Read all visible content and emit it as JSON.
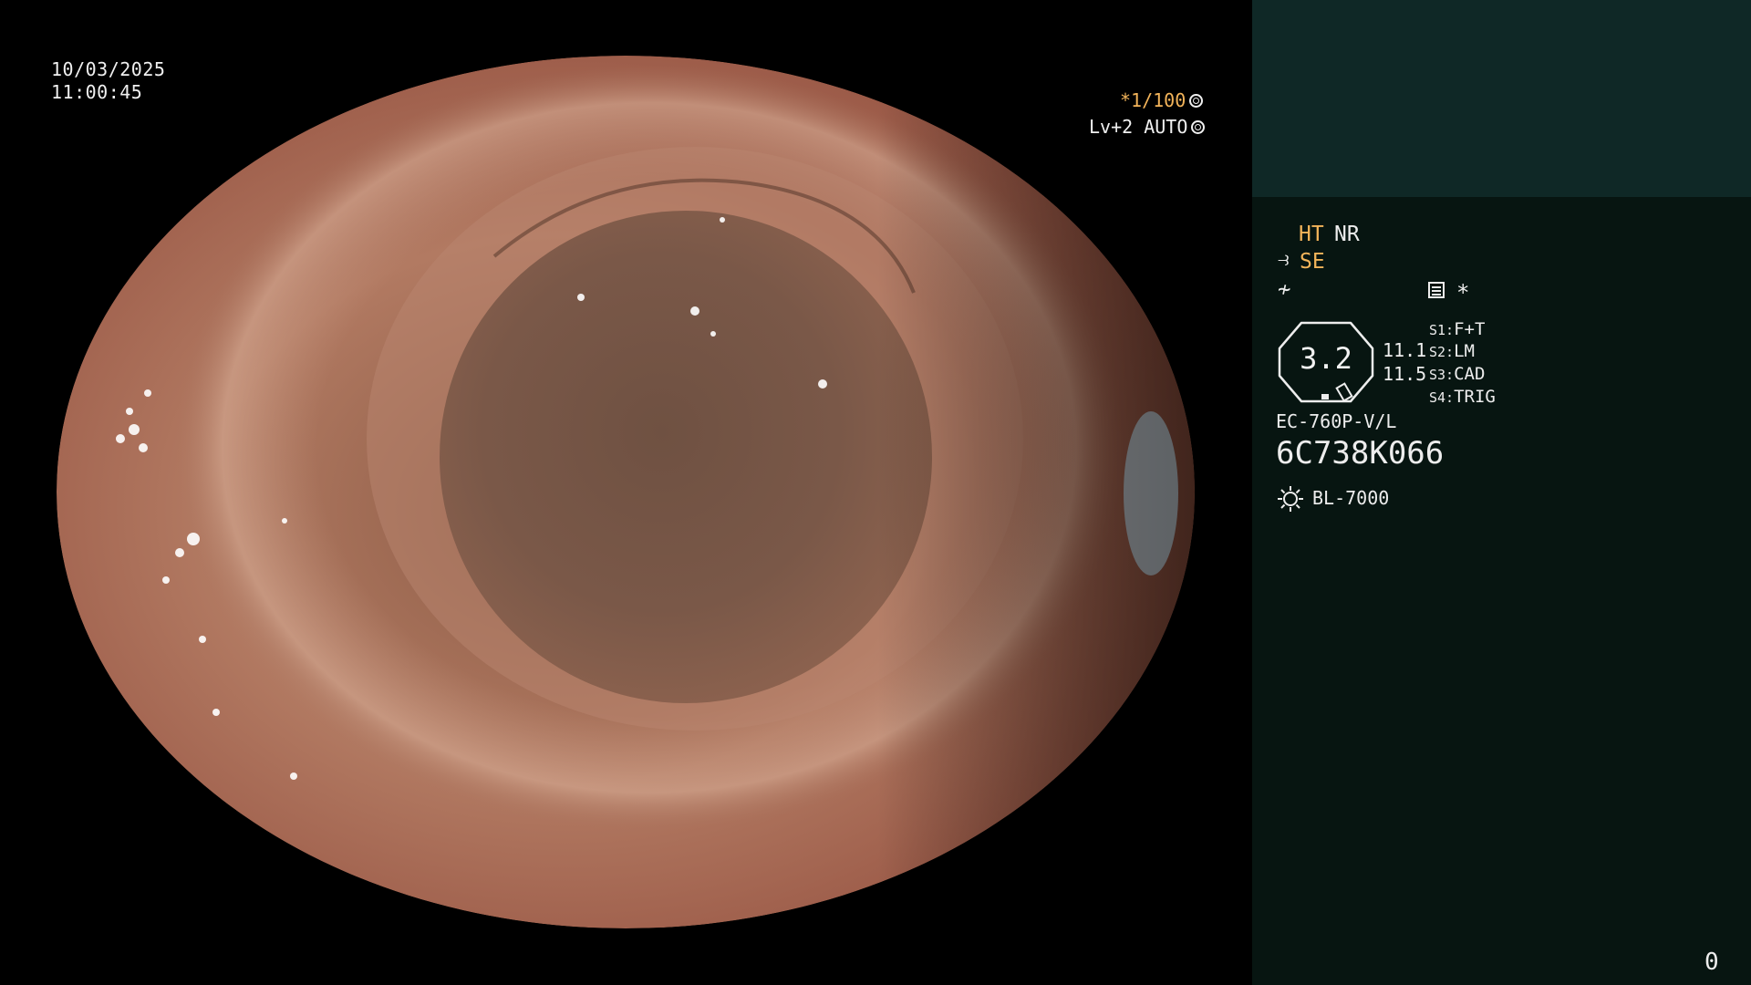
{
  "overlay": {
    "date": "10/03/2025",
    "time": "11:00:45",
    "shutter": "*1/100",
    "iris": "Lv+2 AUTO"
  },
  "panel": {
    "ht": "HT",
    "nr": "NR",
    "se": "SE",
    "star": "*",
    "zoom_value": "3.2",
    "ratio_1": "11.1",
    "ratio_2": "11.5",
    "switches": [
      {
        "key": "S1:",
        "value": "F+T"
      },
      {
        "key": "S2:",
        "value": "LM"
      },
      {
        "key": "S3:",
        "value": "CAD"
      },
      {
        "key": "S4:",
        "value": "TRIG"
      }
    ],
    "scope_model": "EC-760P-V/L",
    "scope_serial": "6C738K066",
    "light_source": "BL-7000",
    "counter": "0"
  },
  "colors": {
    "accent_orange": "#f3b45a",
    "panel_bg": "#071511",
    "panel_header_bg": "#0f2826"
  },
  "icons": [
    "shutter-icon",
    "iris-icon",
    "structure-enhance-icon",
    "color-enhance-icon",
    "menu-icon",
    "light-source-icon"
  ]
}
